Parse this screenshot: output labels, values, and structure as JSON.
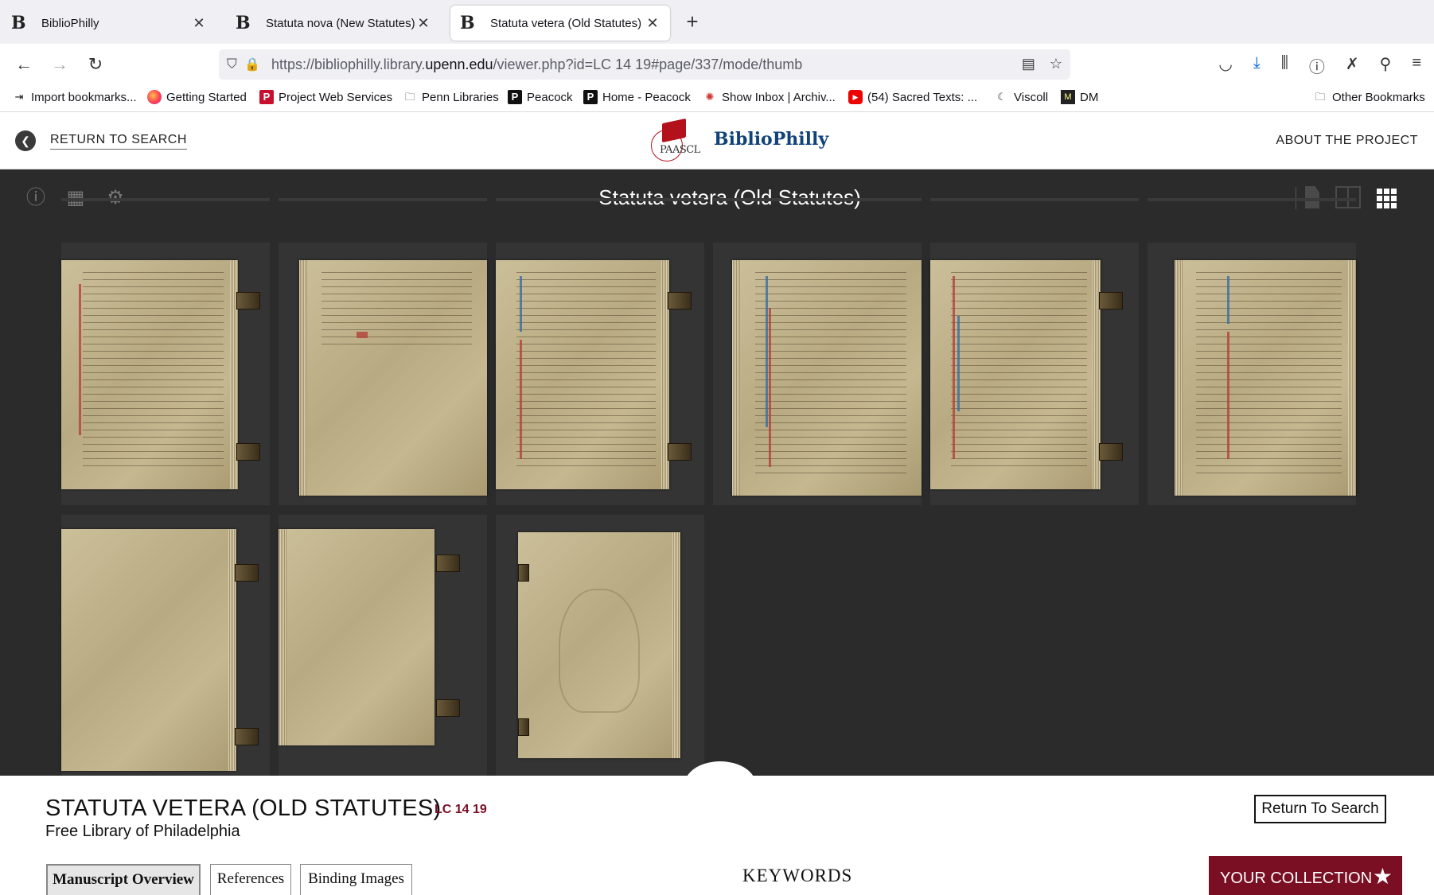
{
  "browser": {
    "tabs": [
      {
        "label": "BiblioPhilly",
        "active": false
      },
      {
        "label": "Statuta nova (New Statutes)",
        "active": false
      },
      {
        "label": "Statuta vetera (Old Statutes)",
        "active": true
      }
    ],
    "new_tab_icon": "+",
    "url_host_prefix": "https://bibliophilly.library.",
    "url_host_main": "upenn.edu",
    "url_path": "/viewer.php?id=LC 14 19#page/337/mode/thumb",
    "bookmarks": [
      {
        "label": "Import bookmarks...",
        "icon": "import-icon"
      },
      {
        "label": "Getting Started",
        "icon": "firefox-icon"
      },
      {
        "label": "Project Web Services",
        "icon": "p-icon"
      },
      {
        "label": "Penn Libraries",
        "icon": "folder-icon"
      },
      {
        "label": "Peacock",
        "icon": "peacock-icon"
      },
      {
        "label": "Home - Peacock",
        "icon": "peacock-icon"
      },
      {
        "label": "Show Inbox | Archiv...",
        "icon": "inbox-icon"
      },
      {
        "label": "(54) Sacred Texts: ...",
        "icon": "youtube-icon"
      },
      {
        "label": "Viscoll",
        "icon": "viscoll-icon"
      },
      {
        "label": "DM",
        "icon": "dm-icon"
      }
    ],
    "other_bookmarks": "Other Bookmarks"
  },
  "site": {
    "return_to_search": "RETURN TO SEARCH",
    "logo_text": "PAASCL",
    "brand": "BiblioPhilly",
    "about": "ABOUT THE PROJECT"
  },
  "viewer": {
    "title": "Statuta vetera (Old Statutes)",
    "tools": [
      "info-icon",
      "thumbnails-icon",
      "settings-icon"
    ],
    "modes": [
      "single-page-mode",
      "two-page-mode",
      "thumbnail-mode"
    ],
    "active_mode": "thumbnail-mode"
  },
  "manuscript": {
    "title": "STATUTA VETERA (OLD STATUTES)",
    "shelfmark": "LC 14 19",
    "repository": "Free Library of Philadelphia",
    "return_button": "Return To Search",
    "tabs": [
      "Manuscript Overview",
      "References",
      "Binding Images"
    ],
    "active_tab": "Manuscript Overview",
    "keywords_heading": "KEYWORDS",
    "collection_button": "YOUR COLLECTION"
  },
  "colors": {
    "accent_maroon": "#7a0f24",
    "brand_blue": "#12427a",
    "viewer_bg": "#2b2b2b"
  }
}
